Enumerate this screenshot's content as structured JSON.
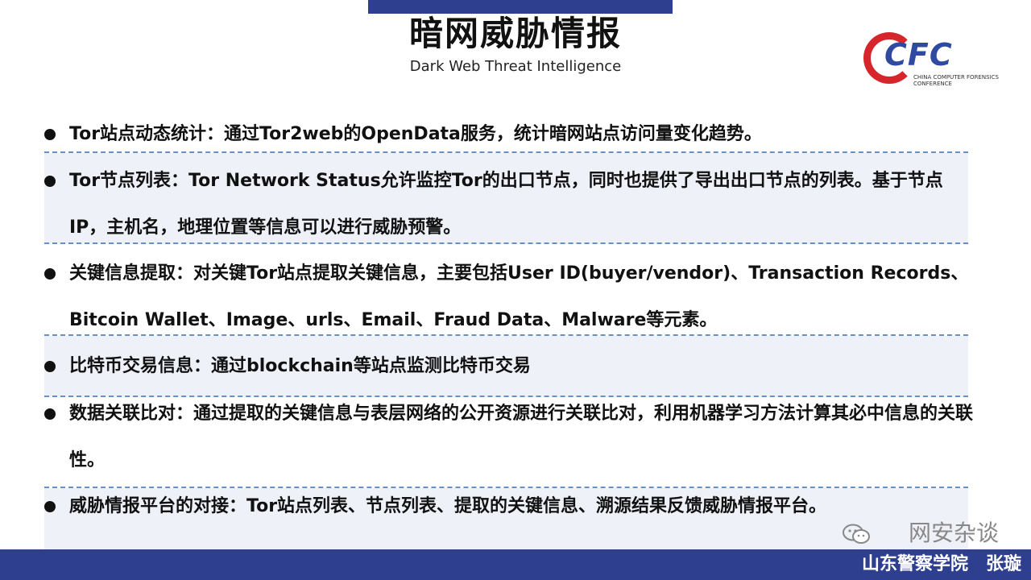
{
  "header": {
    "title": "暗网威胁情报",
    "subtitle": "Dark Web Threat Intelligence"
  },
  "logo": {
    "text": "CFC",
    "sub": "CHINA COMPUTER FORENSICS CONFERENCE",
    "icon": "cfc-logo"
  },
  "items": [
    "Tor站点动态统计：通过Tor2web的OpenData服务，统计暗网站点访问量变化趋势。",
    "Tor节点列表：Tor Network Status允许监控Tor的出口节点，同时也提供了导出出口节点的列表。基于节点IP，主机名，地理位置等信息可以进行威胁预警。",
    "关键信息提取：对关键Tor站点提取关键信息，主要包括User ID(buyer/vendor)、Transaction Records、Bitcoin Wallet、Image、urls、Email、Fraud Data、Malware等元素。",
    "比特币交易信息：通过blockchain等站点监测比特币交易",
    "数据关联比对：通过提取的关键信息与表层网络的公开资源进行关联比对，利用机器学习方法计算其必中信息的关联性。",
    "威胁情报平台的对接：Tor站点列表、节点列表、提取的关键信息、溯源结果反馈威胁情报平台。"
  ],
  "watermark": "网安杂谈",
  "footer": "山东警察学院　张璇",
  "colors": {
    "accent": "#2f3f8f",
    "logo_red": "#d7262b",
    "logo_blue": "#2f4aa0",
    "dash": "#6a8fc4",
    "shade": "#eef2f8"
  }
}
